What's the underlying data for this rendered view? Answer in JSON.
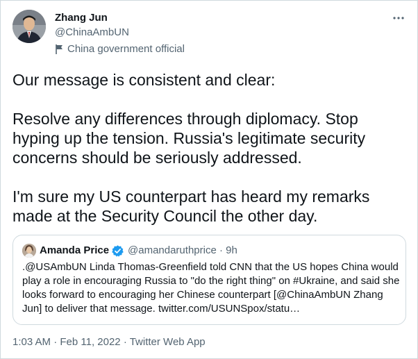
{
  "tweet": {
    "author_name": "Zhang Jun",
    "author_handle": "@ChinaAmbUN",
    "label": "China government official",
    "text": "Our message is consistent and clear:\n\nResolve any differences through diplomacy. Stop hyping up the tension. Russia's legitimate security concerns should be seriously addressed.\n\nI'm sure my US counterpart has heard my remarks made at the Security Council the other day.",
    "timestamp": "1:03 AM · Feb 11, 2022 · Twitter Web App"
  },
  "quoted": {
    "author_name": "Amanda Price",
    "meta": "@amandaruthprice · 9h",
    "text": ".@USAmbUN Linda Thomas-Greenfield told CNN that the US hopes China would play a role in encouraging Russia to \"do the right thing\" on #Ukraine, and said she looks forward to encouraging her Chinese counterpart [@ChinaAmbUN Zhang Jun] to deliver that message. twitter.com/USUNSpox/statu…"
  },
  "icons": {
    "more": "more-horizontal-icon",
    "gov": "flag-icon",
    "verified": "verified-badge-icon"
  },
  "colors": {
    "text": "#0f1419",
    "secondary": "#536471",
    "border": "#cfd9de",
    "verified": "#1d9bf0"
  }
}
